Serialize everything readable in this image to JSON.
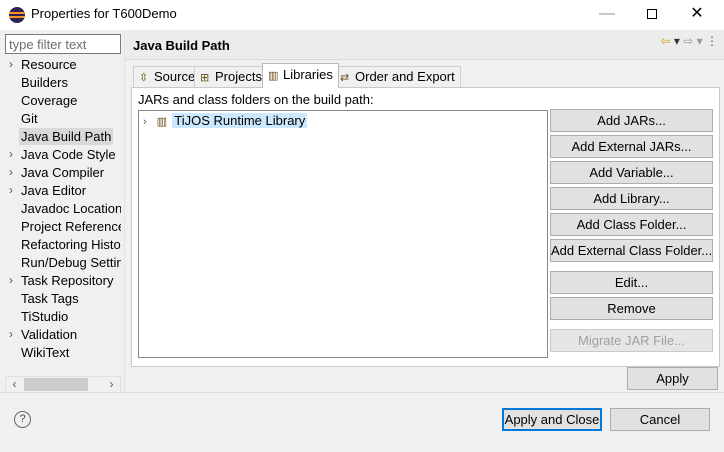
{
  "window": {
    "title": "Properties for T600Demo",
    "min_glyph": "—",
    "close_glyph": "✕"
  },
  "filter": {
    "placeholder": "type filter text",
    "value": ""
  },
  "tree": {
    "items": [
      {
        "label": "Resource",
        "expandable": true
      },
      {
        "label": "Builders",
        "expandable": false
      },
      {
        "label": "Coverage",
        "expandable": false
      },
      {
        "label": "Git",
        "expandable": false
      },
      {
        "label": "Java Build Path",
        "expandable": false,
        "selected": true
      },
      {
        "label": "Java Code Style",
        "expandable": true
      },
      {
        "label": "Java Compiler",
        "expandable": true
      },
      {
        "label": "Java Editor",
        "expandable": true
      },
      {
        "label": "Javadoc Location",
        "expandable": false
      },
      {
        "label": "Project References",
        "expandable": false
      },
      {
        "label": "Refactoring History",
        "expandable": false
      },
      {
        "label": "Run/Debug Settings",
        "expandable": false
      },
      {
        "label": "Task Repository",
        "expandable": true
      },
      {
        "label": "Task Tags",
        "expandable": false
      },
      {
        "label": "TiStudio",
        "expandable": false
      },
      {
        "label": "Validation",
        "expandable": true
      },
      {
        "label": "WikiText",
        "expandable": false
      }
    ],
    "arrow_glyph": "›",
    "scroll_left": "‹",
    "scroll_right": "›"
  },
  "page": {
    "title": "Java Build Path",
    "nav_back": "⇦",
    "nav_back_menu": "▾",
    "nav_forward": "⇨",
    "nav_forward_menu": "▾",
    "view_menu": "⋮"
  },
  "tabs": [
    {
      "label": "Source",
      "icon": "⇳",
      "active": false
    },
    {
      "label": "Projects",
      "icon": "⊞",
      "active": false
    },
    {
      "label": "Libraries",
      "icon": "▥",
      "active": true
    },
    {
      "label": "Order and Export",
      "icon": "⇄",
      "active": false
    }
  ],
  "libraries": {
    "caption": "JARs and class folders on the build path:",
    "entries": [
      {
        "label": "TiJOS Runtime Library",
        "expand_glyph": "›",
        "icon": "▥"
      }
    ]
  },
  "buttons": {
    "add_jars": "Add JARs...",
    "add_external_jars": "Add External JARs...",
    "add_variable": "Add Variable...",
    "add_library": "Add Library...",
    "add_class_folder": "Add Class Folder...",
    "add_external_class_folder": "Add External Class Folder...",
    "edit": "Edit...",
    "remove": "Remove",
    "migrate_jar": "Migrate JAR File...",
    "apply": "Apply",
    "apply_and_close": "Apply and Close",
    "cancel": "Cancel"
  },
  "footer": {
    "help_glyph": "?"
  },
  "colors": {
    "selection": "#cce8ff",
    "default_button_border": "#0078d7"
  }
}
